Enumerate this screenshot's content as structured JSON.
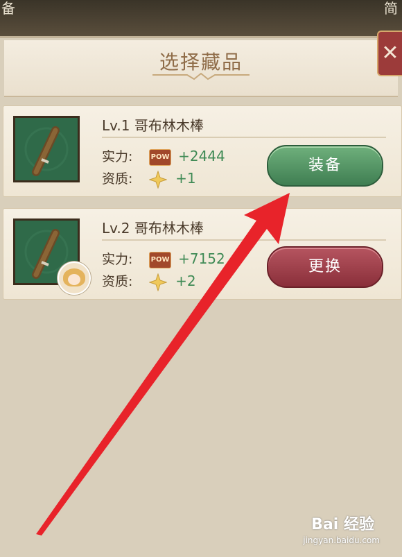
{
  "topbar": {
    "left_char": "备",
    "right_char": "简"
  },
  "dialog": {
    "title": "选择藏品",
    "close_symbol": "✕"
  },
  "items": [
    {
      "name": "Lv.1 哥布林木棒",
      "power_label": "实力:",
      "power_badge": "POW",
      "power_value": "+2444",
      "quality_label": "资质:",
      "quality_value": "+1",
      "action": "装备",
      "action_color": "#4f9462"
    },
    {
      "name": "Lv.2 哥布林木棒",
      "power_label": "实力:",
      "power_badge": "POW",
      "power_value": "+7152",
      "quality_label": "资质:",
      "quality_value": "+2",
      "action": "更换",
      "action_color": "#a23f4b"
    }
  ],
  "watermark": {
    "brand": "Bai 经验",
    "url": "jingyan.baidu.com"
  },
  "colors": {
    "arrow": "#e8232a",
    "frame": "#d9cfbb",
    "title": "#8f6c48"
  }
}
